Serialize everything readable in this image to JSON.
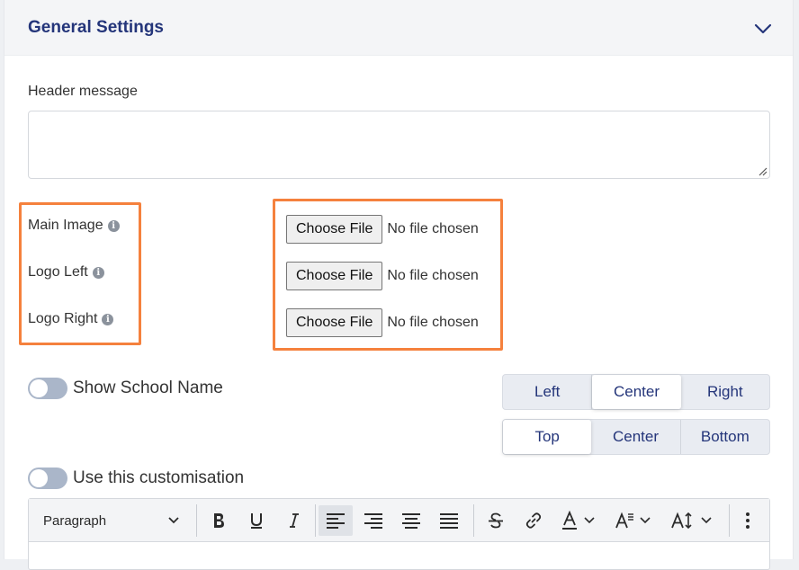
{
  "section": {
    "title": "General Settings"
  },
  "header_message": {
    "label": "Header message",
    "value": "",
    "placeholder": ""
  },
  "images": [
    {
      "label": "Main Image",
      "button": "Choose File",
      "status": "No file chosen"
    },
    {
      "label": "Logo Left",
      "button": "Choose File",
      "status": "No file chosen"
    },
    {
      "label": "Logo Right",
      "button": "Choose File",
      "status": "No file chosen"
    }
  ],
  "info_glyph": "i",
  "show_school_name": {
    "label": "Show School Name",
    "on": false
  },
  "horizontal_align": {
    "options": [
      "Left",
      "Center",
      "Right"
    ],
    "selected": "Center"
  },
  "vertical_align": {
    "options": [
      "Top",
      "Center",
      "Bottom"
    ],
    "selected": "Top"
  },
  "use_customisation": {
    "label": "Use this customisation",
    "on": false
  },
  "editor": {
    "block_format": "Paragraph",
    "active_tool": "align-left"
  },
  "colors": {
    "title": "#24357a",
    "highlight_border": "#f5813d",
    "toggle_off": "#aab6c9"
  }
}
